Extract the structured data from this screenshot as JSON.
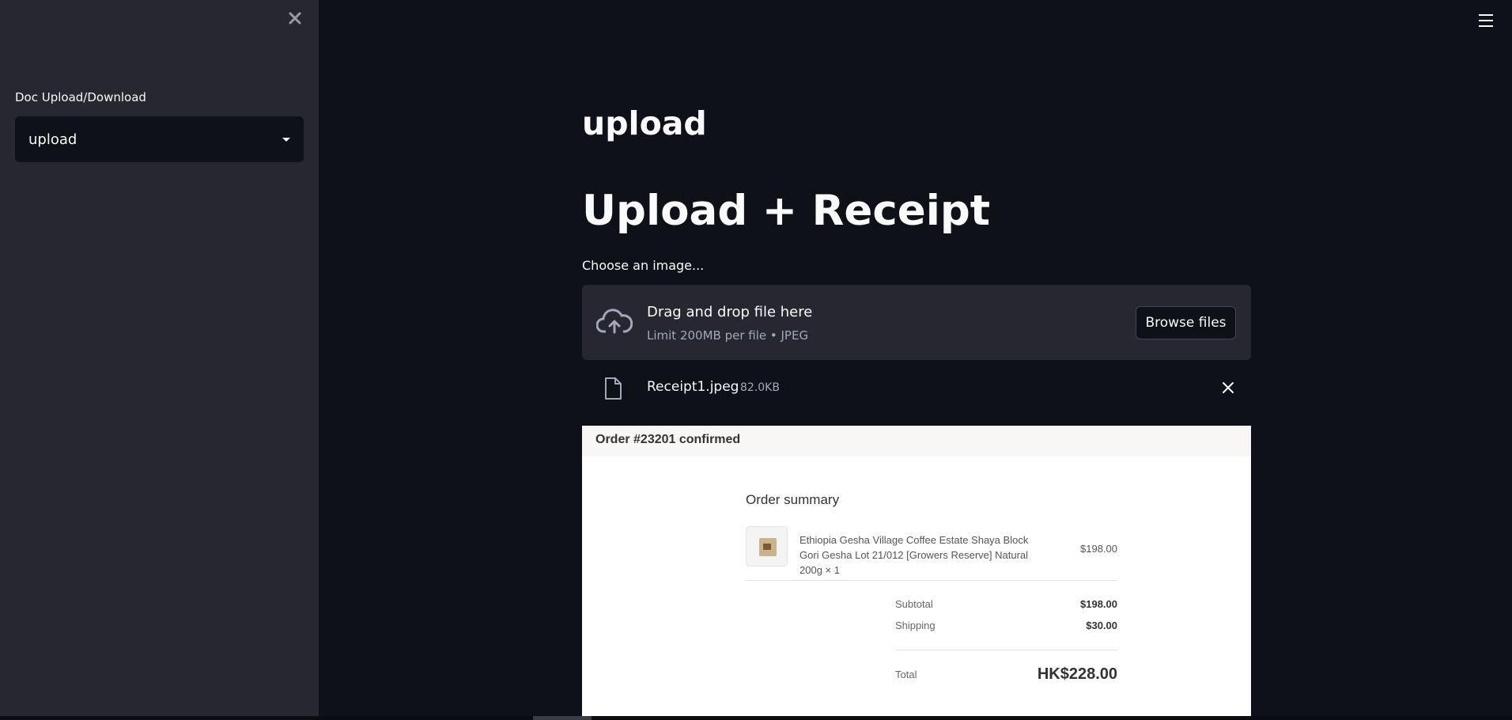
{
  "sidebar": {
    "label": "Doc Upload/Download",
    "select_value": "upload"
  },
  "main": {
    "page_heading": "upload",
    "title": "Upload + Receipt",
    "uploader": {
      "label": "Choose an image...",
      "drop_text": "Drag and drop file here",
      "limit_text": "Limit 200MB per file • JPEG",
      "browse_label": "Browse files"
    },
    "file": {
      "name": "Receipt1.jpeg",
      "size": "82.0KB"
    },
    "receipt": {
      "order_title": "Order #23201 confirmed",
      "summary_title": "Order summary",
      "item_name": "Ethiopia Gesha Village Coffee Estate Shaya Block Gori Gesha Lot 21/012 [Growers Reserve] Natural 200g × 1",
      "item_price": "$198.00",
      "subtotal_label": "Subtotal",
      "subtotal_value": "$198.00",
      "shipping_label": "Shipping",
      "shipping_value": "$30.00",
      "total_label": "Total",
      "total_value": "HK$228.00"
    }
  },
  "colors": {
    "background": "#0e1117",
    "sidebar": "#262730",
    "text": "#fafafa",
    "muted": "#a3a8b8"
  }
}
